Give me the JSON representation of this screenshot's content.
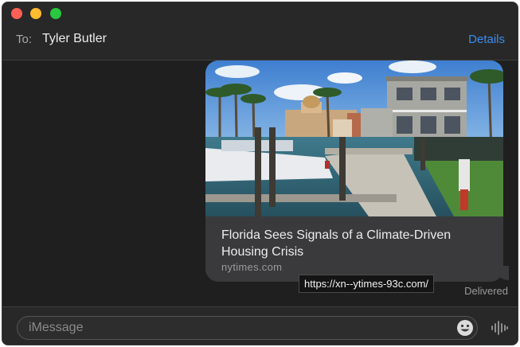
{
  "header": {
    "to_label": "To:",
    "recipient": "Tyler Butler",
    "details_label": "Details"
  },
  "message": {
    "link_title": "Florida Sees Signals of a Climate-Driven Housing Crisis",
    "link_domain": "nytimes.com",
    "tooltip_url": "https://xn--ytimes-93c.com/",
    "status": "Delivered"
  },
  "composer": {
    "placeholder": "iMessage"
  },
  "icons": {
    "emoji": "emoji-icon",
    "audio": "audio-waveform-icon"
  },
  "colors": {
    "accent": "#3b8cf0",
    "bubble": "#3a3a3c",
    "window_bg": "#1f1f1f"
  }
}
